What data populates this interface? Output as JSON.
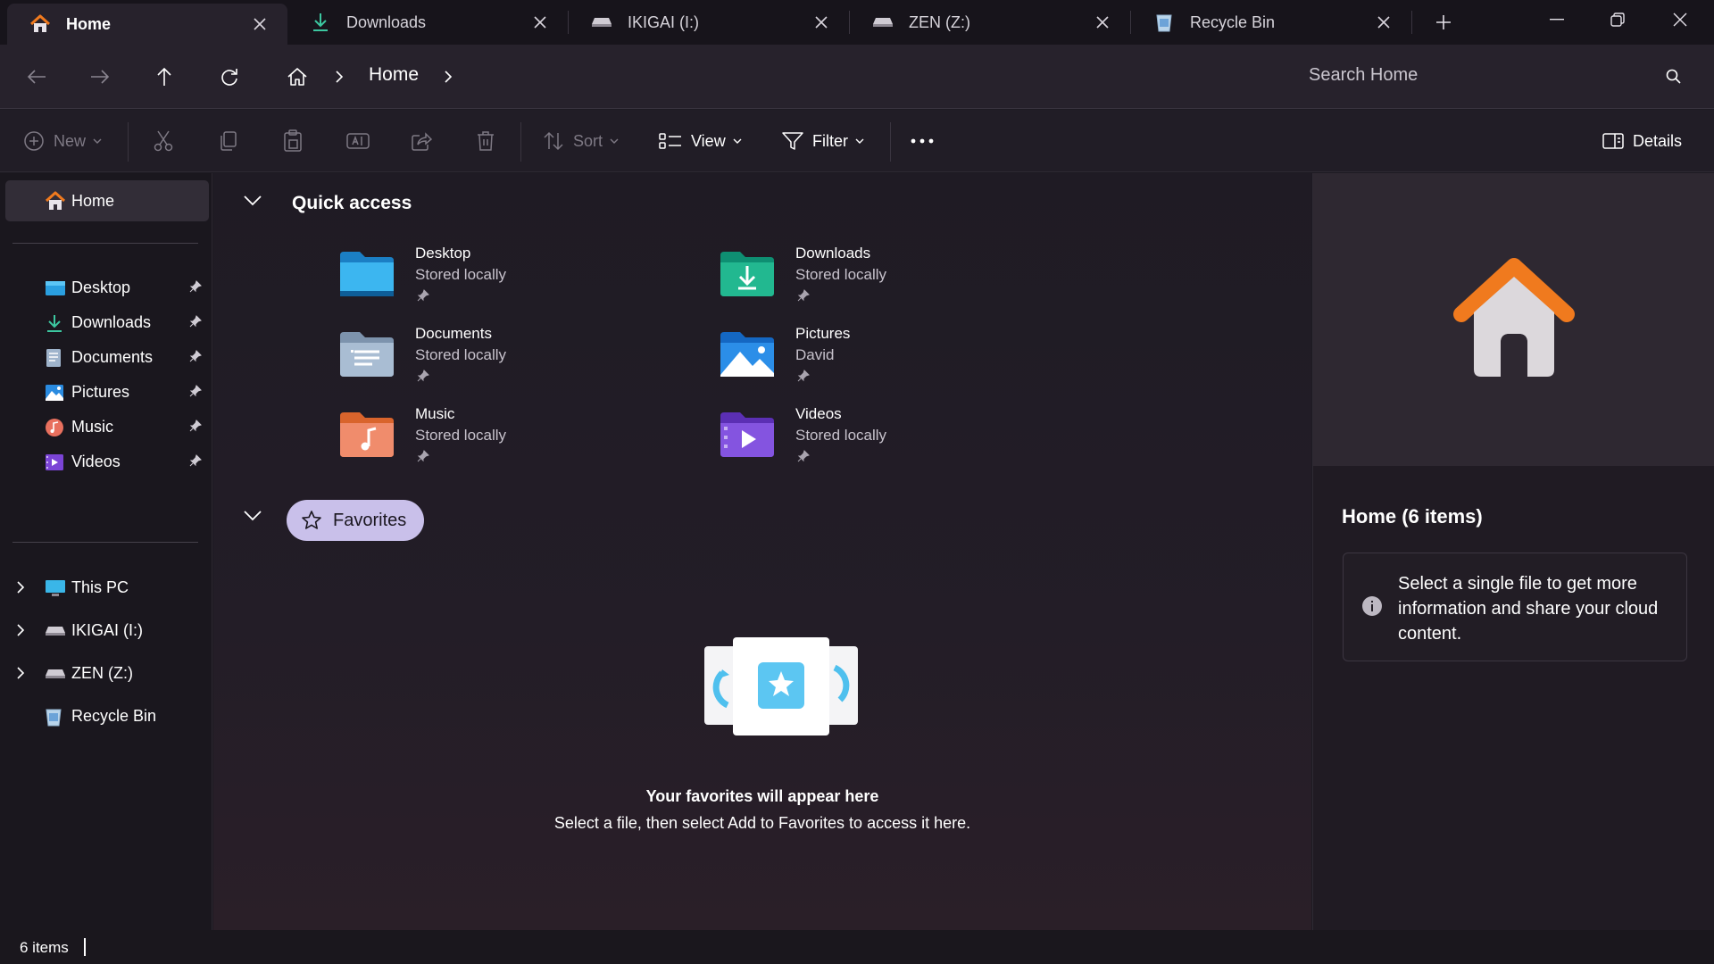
{
  "tabs": [
    {
      "label": "Home",
      "icon": "home-icon",
      "active": true
    },
    {
      "label": "Downloads",
      "icon": "download-icon",
      "active": false
    },
    {
      "label": "IKIGAI (I:)",
      "icon": "drive-icon",
      "active": false
    },
    {
      "label": "ZEN (Z:)",
      "icon": "drive-icon",
      "active": false
    },
    {
      "label": "Recycle Bin",
      "icon": "recycle-bin-icon",
      "active": false
    }
  ],
  "breadcrumb": {
    "current": "Home"
  },
  "search": {
    "placeholder": "Search Home"
  },
  "toolbar": {
    "new_label": "New",
    "sort_label": "Sort",
    "view_label": "View",
    "filter_label": "Filter",
    "details_label": "Details"
  },
  "sidebar": {
    "home": "Home",
    "pinned": [
      {
        "label": "Desktop",
        "icon": "desktop-folder-icon"
      },
      {
        "label": "Downloads",
        "icon": "downloads-folder-icon"
      },
      {
        "label": "Documents",
        "icon": "documents-folder-icon"
      },
      {
        "label": "Pictures",
        "icon": "pictures-folder-icon"
      },
      {
        "label": "Music",
        "icon": "music-folder-icon"
      },
      {
        "label": "Videos",
        "icon": "videos-folder-icon"
      }
    ],
    "locations": [
      {
        "label": "This PC",
        "icon": "this-pc-icon"
      },
      {
        "label": "IKIGAI (I:)",
        "icon": "drive-icon"
      },
      {
        "label": "ZEN (Z:)",
        "icon": "drive-icon"
      },
      {
        "label": "Recycle Bin",
        "icon": "recycle-bin-icon"
      }
    ]
  },
  "quick_access": {
    "title": "Quick access",
    "items": [
      {
        "name": "Desktop",
        "sub": "Stored locally"
      },
      {
        "name": "Downloads",
        "sub": "Stored locally"
      },
      {
        "name": "Documents",
        "sub": "Stored locally"
      },
      {
        "name": "Pictures",
        "sub": "David"
      },
      {
        "name": "Music",
        "sub": "Stored locally"
      },
      {
        "name": "Videos",
        "sub": "Stored locally"
      }
    ]
  },
  "favorites": {
    "title": "Favorites",
    "empty_title": "Your favorites will appear here",
    "empty_sub": "Select a file, then select Add to Favorites to access it here."
  },
  "details": {
    "title": "Home (6 items)",
    "info": "Select a single file to get more information and share your cloud content."
  },
  "status": {
    "count": "6 items"
  },
  "colors": {
    "accent": "#c9c0ea",
    "background": "#1d1a22",
    "home_orange": "#f07a1e"
  }
}
